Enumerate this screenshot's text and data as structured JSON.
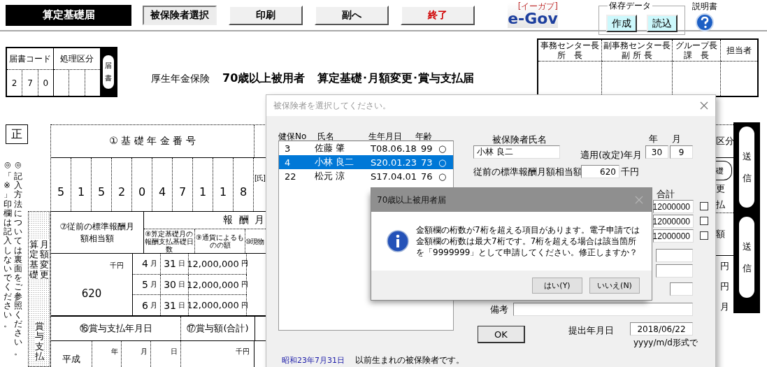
{
  "toolbar": {
    "title": "算定基礎届",
    "buttons": [
      {
        "label": "被保険者選択",
        "kind": "pressed"
      },
      {
        "label": "印刷",
        "kind": "normal"
      },
      {
        "label": "副へ",
        "kind": "normal"
      },
      {
        "label": "終了",
        "kind": "danger"
      }
    ],
    "logo": {
      "text": "e-Gov",
      "reading": "[イーガブ]"
    },
    "saved_data": {
      "legend": "保存データ",
      "buttons": [
        "作成",
        "読込"
      ]
    },
    "manual": {
      "label": "説明書"
    }
  },
  "header": {
    "code_box": {
      "code_label": "届書コード",
      "process_label": "処理区分",
      "code_digits": [
        "2",
        "7",
        "0"
      ],
      "badge": "届書"
    },
    "insurance": "厚生年金保険",
    "subject": "70歳以上被用者",
    "form_name": "算定基礎･月額変更･賞与支払届",
    "stamp_columns": [
      {
        "lines": [
          "事務センター長",
          "所　長"
        ]
      },
      {
        "lines": [
          "副事務センター長",
          "副 所 長"
        ]
      },
      {
        "lines": [
          "グループ長",
          "課　長"
        ]
      },
      {
        "lines": [
          "担当者"
        ]
      }
    ]
  },
  "form": {
    "copy_mark": "正",
    "notes": [
      {
        "mark": "◎",
        "text": "「※」印欄は記入しないでください。"
      },
      {
        "mark": "◎",
        "text": "記入方法については裏面をご参照ください。"
      }
    ],
    "side_labels": {
      "monthly": [
        "算定基礎",
        "月額変更"
      ],
      "bonus": "賞与支払"
    },
    "pension_no": {
      "label": "① 基 礎 年 金 番 号",
      "digits": [
        "5",
        "1",
        "5",
        "2",
        "0",
        "4",
        "7",
        "1",
        "1",
        "8"
      ]
    },
    "name_label": "[氏]",
    "prev_standard": {
      "label": "⑦従前の標準報酬月額相当額",
      "unit": "千円",
      "value": "620"
    },
    "remuneration": {
      "label": "報 酬 月",
      "columns": [
        "⑧算定基礎月の報酬支払基礎日数",
        "⑨通貨によるものの額",
        "⑩現物"
      ],
      "rows": [
        {
          "month": "4",
          "month_unit": "月",
          "days": "31",
          "day_unit": "日",
          "amount": "12,000,000",
          "amount_unit": "円"
        },
        {
          "month": "5",
          "month_unit": "月",
          "days": "30",
          "day_unit": "日",
          "amount": "12,000,000",
          "amount_unit": "円"
        },
        {
          "month": "6",
          "month_unit": "月",
          "days": "31",
          "day_unit": "日",
          "amount": "12,000,000",
          "amount_unit": "円"
        }
      ]
    },
    "bonus": {
      "date_label": "⑯賞与支払年月日",
      "amount_label": "⑰賞与額(合計)",
      "era": "平成",
      "year_unit": "年",
      "month_unit": "月",
      "day_unit": "日",
      "amount_unit": "千円"
    },
    "right_edge": {
      "cells": [
        "区分",
        "礎",
        "更",
        "払",
        "額",
        "円",
        "円",
        "月"
      ],
      "send_buttons": [
        "送信",
        "送信"
      ]
    }
  },
  "dialog": {
    "title": "被保険者を選択してください。",
    "list": {
      "columns": [
        "健保No",
        "氏名",
        "生年月日",
        "年齢"
      ],
      "rows": [
        {
          "no": "3",
          "name": "佐藤 肇",
          "birth": "T08.06.18",
          "age": "99",
          "mark": "○",
          "selected": false
        },
        {
          "no": "4",
          "name": "小林 良二",
          "birth": "S20.01.23",
          "age": "73",
          "mark": "○",
          "selected": true
        },
        {
          "no": "22",
          "name": "松元 涼",
          "birth": "S17.04.01",
          "age": "76",
          "mark": "○",
          "selected": false
        }
      ]
    },
    "name_label": "被保険者氏名",
    "name_value": "小林 良二",
    "year_label": "年",
    "month_label": "月",
    "apply_label": "適用(改定)年月",
    "apply_year": "30",
    "apply_month": "9",
    "prev_label": "従前の標準報酬月額相当額",
    "prev_value": "620",
    "prev_unit": "千円",
    "total_label": "合計",
    "totals": [
      {
        "value": "12000000",
        "checked": false
      },
      {
        "value": "12000000",
        "checked": false
      },
      {
        "value": "12000000",
        "checked": false
      }
    ],
    "remarks_label": "備考",
    "ok": "OK",
    "submit_label": "提出年月日",
    "submit_value": "2018/06/22",
    "submit_hint": "yyyy/m/d形式で",
    "footer_date": "昭和23年7月31日",
    "footer_text": "以前生まれの被保険者です。"
  },
  "message_box": {
    "title": "70歳以上被用者届",
    "message": "金額欄の桁数が7桁を超える項目があります。電子申請では金額欄の桁数は最大7桁です。7桁を超える場合は該当箇所を「9999999」として申請してください。修正しますか？",
    "buttons": [
      "はい(Y)",
      "いいえ(N)"
    ]
  }
}
